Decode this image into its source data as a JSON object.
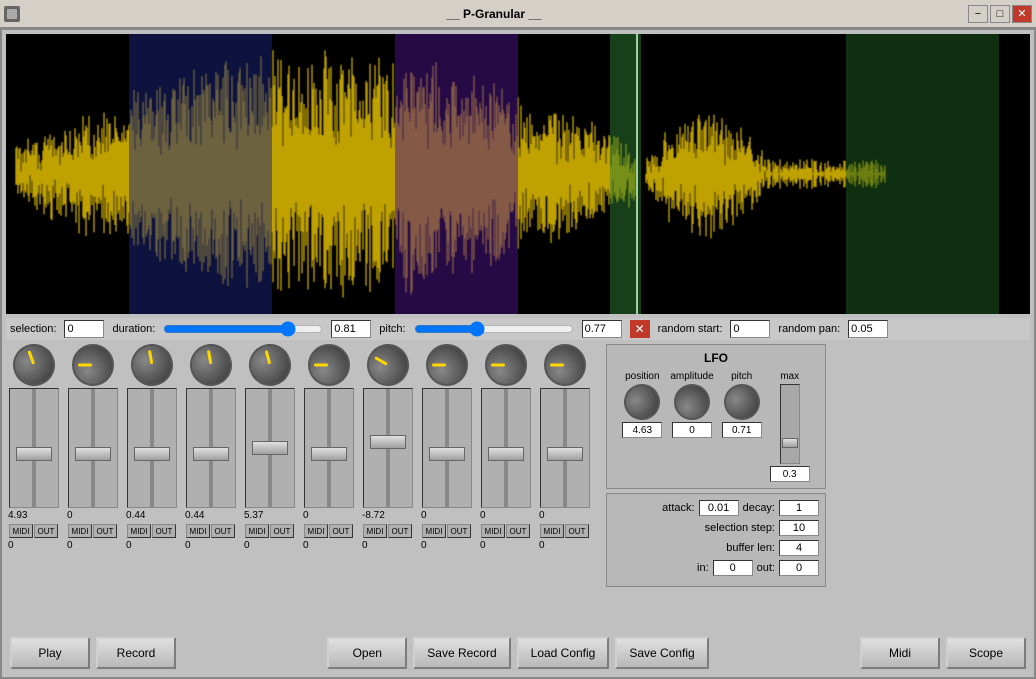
{
  "titlebar": {
    "title": "__ P-Granular __",
    "icon": "app-icon",
    "minimize": "−",
    "maximize": "□",
    "close": "✕"
  },
  "controls": {
    "selection_label": "selection:",
    "selection_value": "0",
    "duration_label": "duration:",
    "duration_value": "0.81",
    "pitch_label": "pitch:",
    "pitch_value": "0.77",
    "random_start_label": "random start:",
    "random_start_value": "0",
    "random_pan_label": "random pan:",
    "random_pan_value": "0.05"
  },
  "knob_columns": [
    {
      "value": "4.93",
      "midi_out": "0"
    },
    {
      "value": "0",
      "midi_out": "0"
    },
    {
      "value": "0.44",
      "midi_out": "0"
    },
    {
      "value": "0.44",
      "midi_out": "0"
    },
    {
      "value": "5.37",
      "midi_out": "0"
    },
    {
      "value": "0",
      "midi_out": "0"
    },
    {
      "value": "-8.72",
      "midi_out": "0"
    },
    {
      "value": "0",
      "midi_out": "0"
    },
    {
      "value": "0",
      "midi_out": "0"
    },
    {
      "value": "0",
      "midi_out": "0"
    }
  ],
  "lfo": {
    "title": "LFO",
    "position_label": "position",
    "amplitude_label": "amplitude",
    "pitch_label": "pitch",
    "max_label": "max",
    "position_value": "4.63",
    "amplitude_value": "0",
    "pitch_value": "0.71",
    "max_value": "0.3"
  },
  "settings": {
    "attack_label": "attack:",
    "attack_value": "0.01",
    "decay_label": "decay:",
    "decay_value": "1",
    "selection_step_label": "selection step:",
    "selection_step_value": "10",
    "buffer_len_label": "buffer len:",
    "buffer_len_value": "4",
    "in_label": "in:",
    "in_value": "0",
    "out_label": "out:",
    "out_value": "0"
  },
  "buttons": {
    "play": "Play",
    "record": "Record",
    "open": "Open",
    "save_record": "Save Record",
    "load_config": "Load Config",
    "save_config": "Save Config",
    "midi": "Midi",
    "scope": "Scope"
  }
}
